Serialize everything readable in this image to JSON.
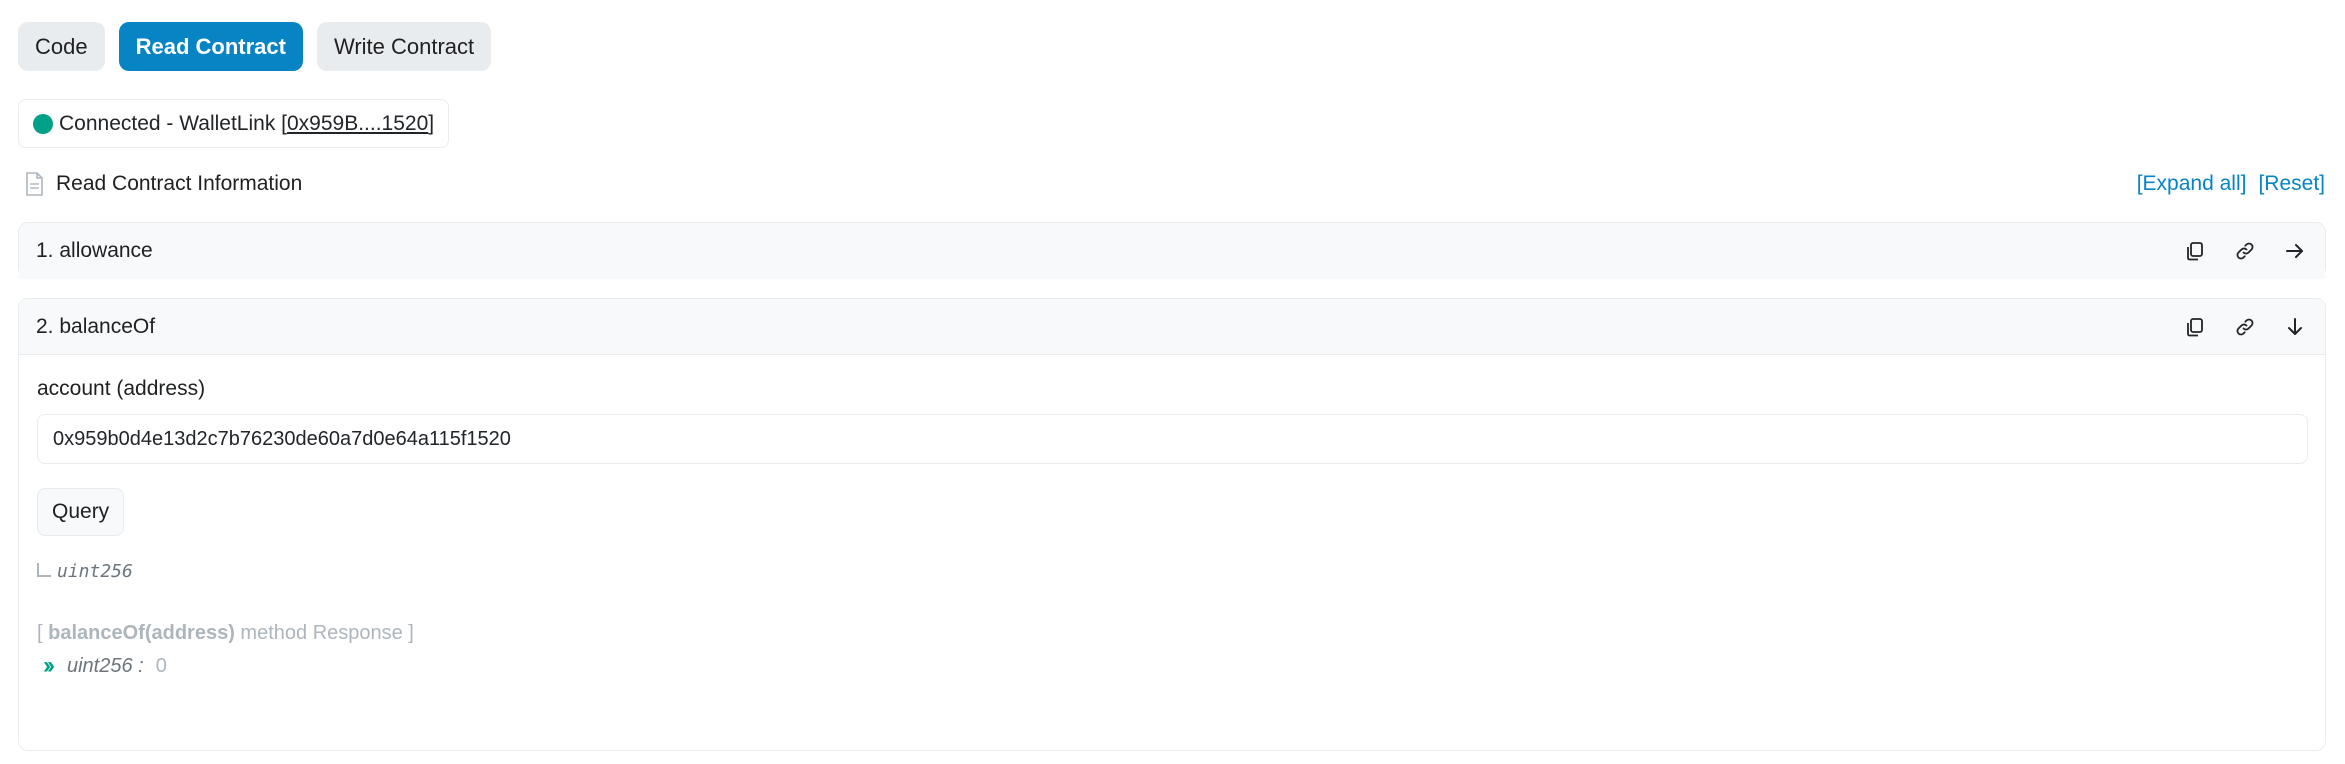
{
  "tabs": [
    {
      "label": "Code"
    },
    {
      "label": "Read Contract"
    },
    {
      "label": "Write Contract"
    }
  ],
  "connection": {
    "status_text": "Connected - WalletLink [",
    "address_short": "0x959B....1520",
    "close_bracket": "]",
    "status_color": "#00a186"
  },
  "info": {
    "title": "Read Contract Information",
    "expand_all": "[Expand all]",
    "reset": "[Reset]"
  },
  "functions": [
    {
      "title": "1. allowance",
      "expanded": false
    },
    {
      "title": "2. balanceOf",
      "expanded": true
    }
  ],
  "balanceOf": {
    "param_label": "account (address)",
    "param_value": "0x959b0d4e13d2c7b76230de60a7d0e64a115f1520",
    "query_label": "Query",
    "return_type": "uint256",
    "response_open": "[",
    "response_method": "balanceOf(address)",
    "response_text": "method Response ]",
    "response_type": "uint256 :",
    "response_value": "0"
  },
  "colors": {
    "accent": "#0784c3",
    "success": "#00a186"
  }
}
